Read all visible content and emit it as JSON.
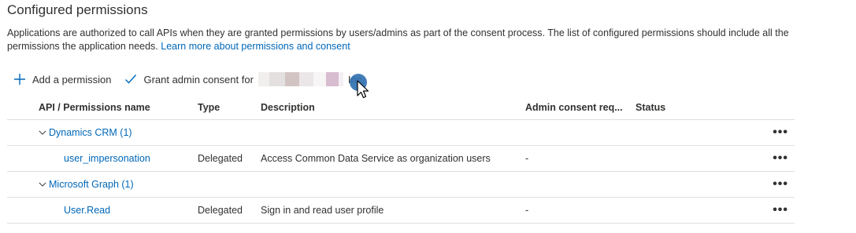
{
  "header": {
    "title": "Configured permissions",
    "description": "Applications are authorized to call APIs when they are granted permissions by users/admins as part of the consent process. The list of configured permissions should include all the permissions the application needs.",
    "learn_more": "Learn more about permissions and consent"
  },
  "toolbar": {
    "add_label": "Add a permission",
    "grant_label": "Grant admin consent for",
    "org_suffix": "Inc."
  },
  "columns": {
    "name": "API / Permissions name",
    "type": "Type",
    "description": "Description",
    "admin": "Admin consent req...",
    "status": "Status"
  },
  "groups": [
    {
      "name": "Dynamics CRM (1)",
      "permissions": [
        {
          "name": "user_impersonation",
          "type": "Delegated",
          "description": "Access Common Data Service as organization users",
          "admin": "-",
          "status": ""
        }
      ]
    },
    {
      "name": "Microsoft Graph (1)",
      "permissions": [
        {
          "name": "User.Read",
          "type": "Delegated",
          "description": "Sign in and read user profile",
          "admin": "-",
          "status": ""
        }
      ]
    }
  ],
  "more_glyph": "•••",
  "colors": {
    "link": "#0067b8",
    "cursor_highlight": "#2f6fb0"
  }
}
